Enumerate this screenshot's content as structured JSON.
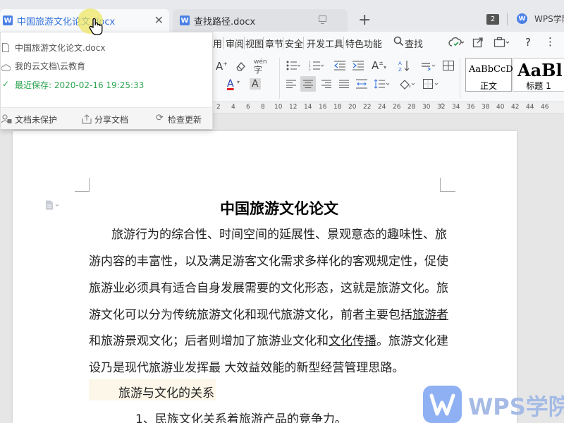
{
  "tabs": [
    {
      "title": "中国旅游文化论文.docx"
    },
    {
      "title": "查找路径.docx"
    }
  ],
  "tab_counter": "2",
  "wps_tab": "WPS学院",
  "menu": [
    "用",
    "审阅",
    "视图",
    "章节",
    "安全",
    "开发工具",
    "特色功能"
  ],
  "search": {
    "label": "查找"
  },
  "ribbon_icons": {
    "font_grow": "A",
    "font_color": "A",
    "char_shade": "A",
    "char_border": "A",
    "pinyin": "wén"
  },
  "styles": [
    {
      "sample": "AaBbCcDd",
      "label": "正文"
    },
    {
      "sample": "AaBl",
      "label": "标题 1"
    }
  ],
  "ruler_ticks": [
    "2",
    "4",
    "6",
    "8",
    "10",
    "12",
    "14",
    "16",
    "18",
    "20",
    "22",
    "24",
    "26",
    "28",
    "30",
    "32",
    "34",
    "36",
    "38",
    "40",
    "42",
    "44",
    "46"
  ],
  "popup": {
    "filename": "中国旅游文化论文.docx",
    "location": "我的云文档\\云教育",
    "saved": "最近保存: 2020-02-16 19:25:33",
    "unprotected": "文档未保护",
    "share": "分享文档",
    "check_update": "检查更新"
  },
  "document": {
    "title": "中国旅游文化论文",
    "lines": [
      "旅游行为的综合性、时间空间的延展性、景观意态的趣味性、旅",
      "游内容的丰富性，以及满足游客文化需求多样化的客观规定性，促使",
      "旅游业必须具有适合自身发展需要的文化形态，这就是旅游文化。旅",
      "游文化可以分为传统旅游文化和现代旅游文化，前者主要包括",
      "旅游者",
      "和旅游景观文化；后者则增加了旅游业文化和",
      "文化传播",
      "。旅游文化建",
      "设乃是现代旅游业发挥最 大效益效能的新型经营管理思路。"
    ],
    "subheading": "旅游与文化的关系",
    "list_item": "1、民族文化关系着旅游产品的竞争力。"
  },
  "watermark": "WPS学院",
  "colors": {
    "accent": "#3575e0",
    "saved_green": "#2ea44f",
    "font_red": "#e02020"
  }
}
